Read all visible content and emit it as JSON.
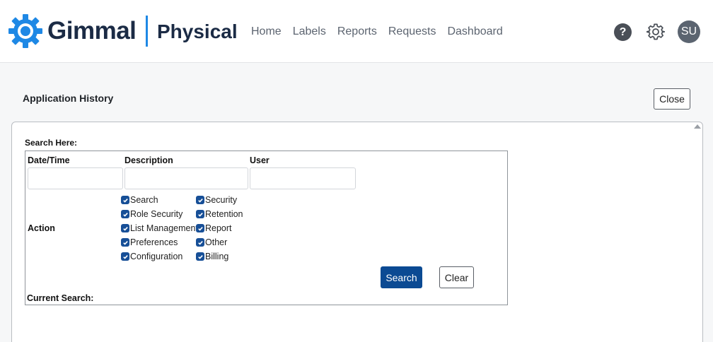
{
  "header": {
    "brand": "Gimmal",
    "product": "Physical",
    "nav": [
      "Home",
      "Labels",
      "Reports",
      "Requests",
      "Dashboard"
    ],
    "help_glyph": "?",
    "avatar_initials": "SU",
    "logo_color": "#1e88e5"
  },
  "page": {
    "title": "Application History",
    "close_label": "Close"
  },
  "search": {
    "heading": "Search Here:",
    "columns": {
      "datetime": "Date/Time",
      "description": "Description",
      "user": "User"
    },
    "datetime_value": "",
    "description_value": "",
    "user_value": "",
    "action_label": "Action",
    "actions_left": [
      {
        "label": "Search",
        "checked": true
      },
      {
        "label": "Role Security",
        "checked": true
      },
      {
        "label": "List Management",
        "checked": true
      },
      {
        "label": "Preferences",
        "checked": true
      },
      {
        "label": "Configuration",
        "checked": true
      }
    ],
    "actions_right": [
      {
        "label": "Security",
        "checked": true
      },
      {
        "label": "Retention",
        "checked": true
      },
      {
        "label": "Report",
        "checked": true
      },
      {
        "label": "Other",
        "checked": true
      },
      {
        "label": "Billing",
        "checked": true
      }
    ],
    "search_button": "Search",
    "clear_button": "Clear",
    "current_search_label": "Current Search:",
    "accent_color": "#0b4a93"
  }
}
